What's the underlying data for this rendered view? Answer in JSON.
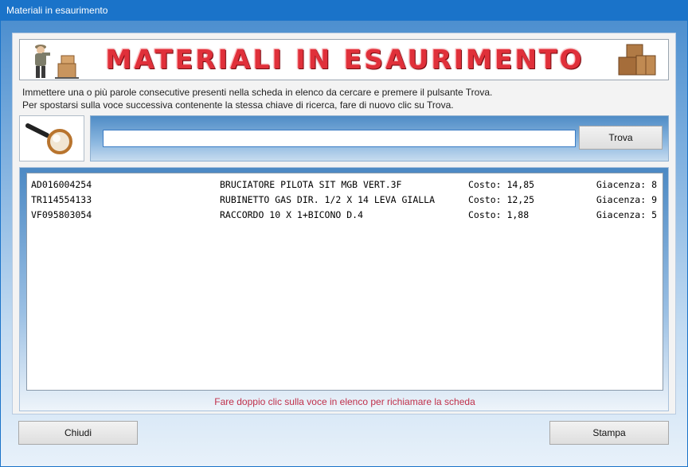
{
  "window": {
    "title": "Materiali in esaurimento"
  },
  "banner": {
    "title": "MATERIALI IN ESAURIMENTO"
  },
  "instructions": {
    "line1": "Immettere una o più parole consecutive presenti nella scheda in elenco da cercare e premere il pulsante Trova.",
    "line2": "Per spostarsi sulla voce successiva contenente la stessa chiave di ricerca, fare di nuovo clic su Trova."
  },
  "search": {
    "value": "",
    "button_label": "Trova"
  },
  "list": {
    "items": [
      {
        "code": "AD016004254",
        "description": "BRUCIATORE PILOTA SIT MGB VERT.3F",
        "cost": "Costo: 14,85",
        "stock": "Giacenza: 8"
      },
      {
        "code": "TR114554133",
        "description": "RUBINETTO GAS DIR. 1/2 X 14 LEVA GIALLA",
        "cost": "Costo: 12,25",
        "stock": "Giacenza: 9"
      },
      {
        "code": "VF095803054",
        "description": "RACCORDO 10 X 1+BICONO D.4",
        "cost": "Costo: 1,88",
        "stock": "Giacenza: 5"
      }
    ],
    "hint": "Fare doppio clic sulla voce in elenco per richiamare la scheda"
  },
  "buttons": {
    "close_label": "Chiudi",
    "print_label": "Stampa"
  },
  "colors": {
    "titlebar": "#1a73c9",
    "banner_text": "#e0303a",
    "hint_text": "#c0304a"
  },
  "icons": {
    "worker": "worker-with-boxes-icon",
    "boxes": "cardboard-boxes-icon",
    "search": "magnifying-glass-icon"
  }
}
